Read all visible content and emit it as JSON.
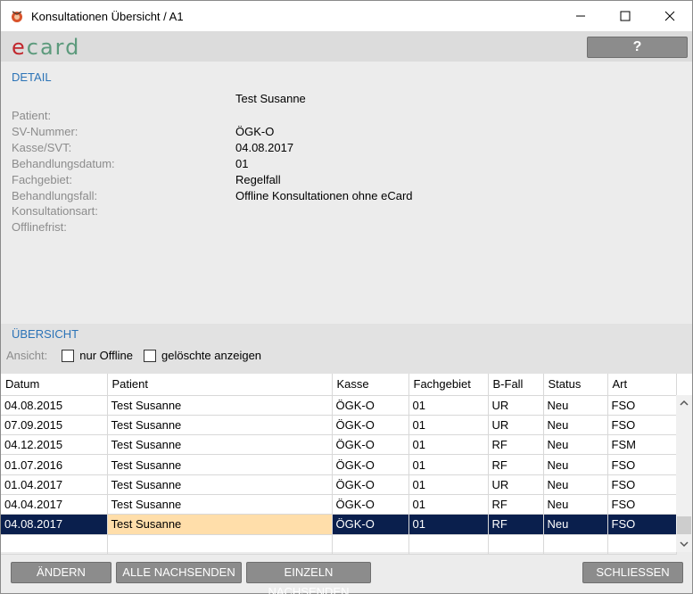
{
  "window": {
    "title": "Konsultationen Übersicht / A1"
  },
  "header": {
    "logo_e": "e",
    "logo_rest": "card",
    "help_label": "?"
  },
  "detail": {
    "section_title": "DETAIL",
    "patient_name": "Test Susanne",
    "labels": [
      "Patient:",
      "SV-Nummer:",
      "Kasse/SVT:",
      "Behandlungsdatum:",
      "Fachgebiet:",
      "Behandlungsfall:",
      "Konsultationsart:",
      "Offlinefrist:"
    ],
    "values": [
      "ÖGK-O",
      "04.08.2017",
      "01",
      "Regelfall",
      "Offline Konsultationen ohne eCard"
    ]
  },
  "overview": {
    "section_title": "ÜBERSICHT",
    "filter_label": "Ansicht:",
    "only_offline_label": "nur Offline",
    "show_deleted_label": "gelöschte anzeigen"
  },
  "table": {
    "columns": [
      "Datum",
      "Patient",
      "Kasse",
      "Fachgebiet",
      "B-Fall",
      "Status",
      "Art"
    ],
    "rows": [
      [
        "04.08.2015",
        "Test Susanne",
        "ÖGK-O",
        "01",
        "UR",
        "Neu",
        "FSO"
      ],
      [
        "07.09.2015",
        "Test Susanne",
        "ÖGK-O",
        "01",
        "UR",
        "Neu",
        "FSO"
      ],
      [
        "04.12.2015",
        "Test Susanne",
        "ÖGK-O",
        "01",
        "RF",
        "Neu",
        "FSM"
      ],
      [
        "01.07.2016",
        "Test Susanne",
        "ÖGK-O",
        "01",
        "RF",
        "Neu",
        "FSO"
      ],
      [
        "01.04.2017",
        "Test Susanne",
        "ÖGK-O",
        "01",
        "UR",
        "Neu",
        "FSO"
      ],
      [
        "04.04.2017",
        "Test Susanne",
        "ÖGK-O",
        "01",
        "RF",
        "Neu",
        "FSO"
      ],
      [
        "04.08.2017",
        "Test Susanne",
        "ÖGK-O",
        "01",
        "RF",
        "Neu",
        "FSO"
      ]
    ],
    "selected_row": 6
  },
  "buttons": {
    "change": "ÄNDERN",
    "send_all": "ALLE NACHSENDEN",
    "send_single": "EINZELN NACHSENDEN",
    "close": "SCHLIESSEN"
  },
  "colors": {
    "section_title": "#2b73b7",
    "button_bg": "#8c8c8c",
    "selected_row": "#0a1f4d",
    "selected_patient_cell": "#ffdeaa",
    "logo_e": "#c1272d",
    "logo_card": "#5c9a7c"
  }
}
